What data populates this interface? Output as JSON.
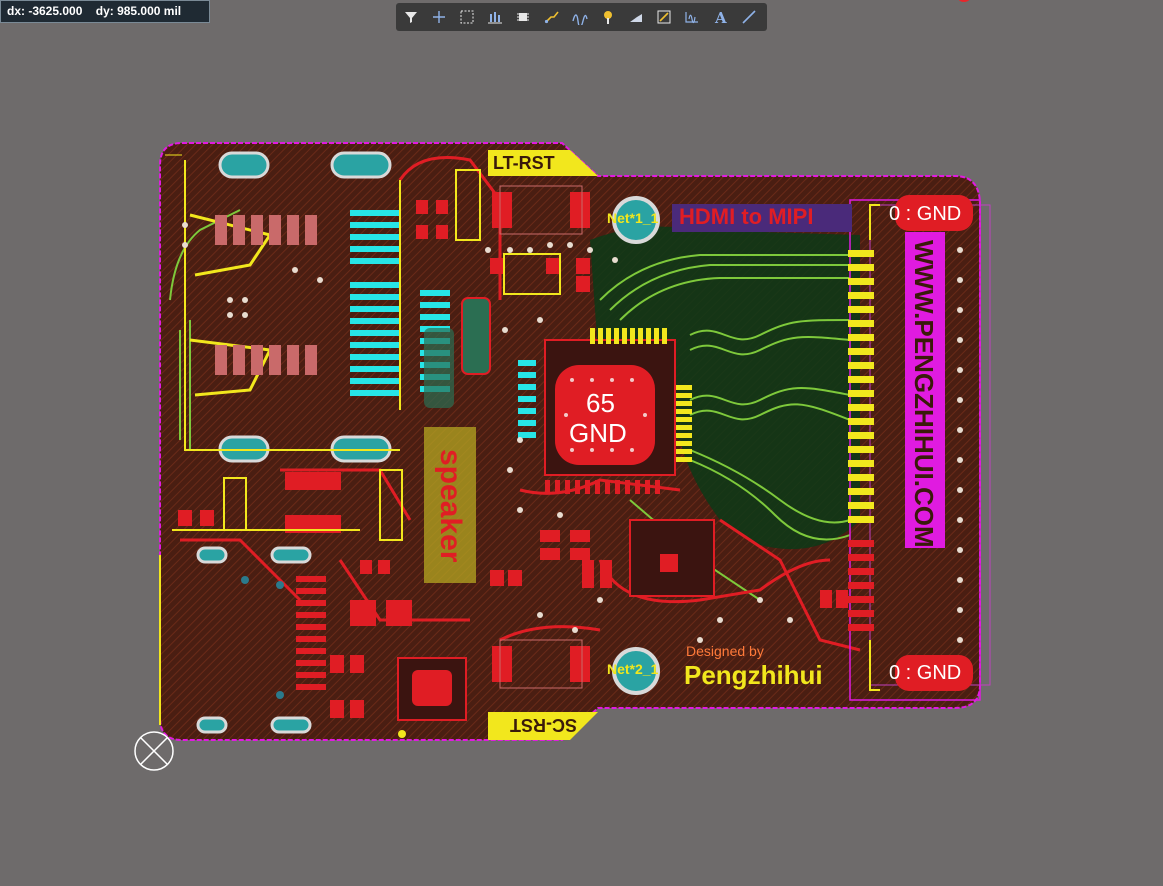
{
  "status_bar": {
    "dx": "dx: -3625.000",
    "dy": "dy:  985.000 mil"
  },
  "toolbar": {
    "tools": [
      {
        "name": "filter-icon"
      },
      {
        "name": "add-icon"
      },
      {
        "name": "select-rect-icon"
      },
      {
        "name": "align-icon"
      },
      {
        "name": "component-icon"
      },
      {
        "name": "route-icon"
      },
      {
        "name": "diff-pair-icon"
      },
      {
        "name": "via-icon"
      },
      {
        "name": "fill-icon"
      },
      {
        "name": "polygon-icon"
      },
      {
        "name": "dimension-icon"
      },
      {
        "name": "text-icon"
      },
      {
        "name": "line-icon"
      }
    ],
    "active_color": "#ffffff"
  },
  "board": {
    "silk_lt_rst": "LT-RST",
    "silk_sc_rst": "SC-RST",
    "net1": "Net*1_1",
    "net2": "Net*2_1",
    "title_text": "HDMI to MIPI",
    "gnd_top": "0 : GND",
    "gnd_bottom": "0 : GND",
    "chip_count": "65",
    "chip_net": "GND",
    "website": "WWW.PENGZHIHUI.COM",
    "designed_by": "Designed by",
    "designer": "Pengzhihui",
    "speaker": "speaker",
    "colors": {
      "board_fill": "#4a1e12",
      "silk_yellow": "#f2e71d",
      "copper_red": "#e01d24",
      "cyan_pads": "#27e5e7",
      "green_traces": "#3d9a3a",
      "magenta": "#e01be0",
      "background": "#6e6b6b"
    }
  }
}
